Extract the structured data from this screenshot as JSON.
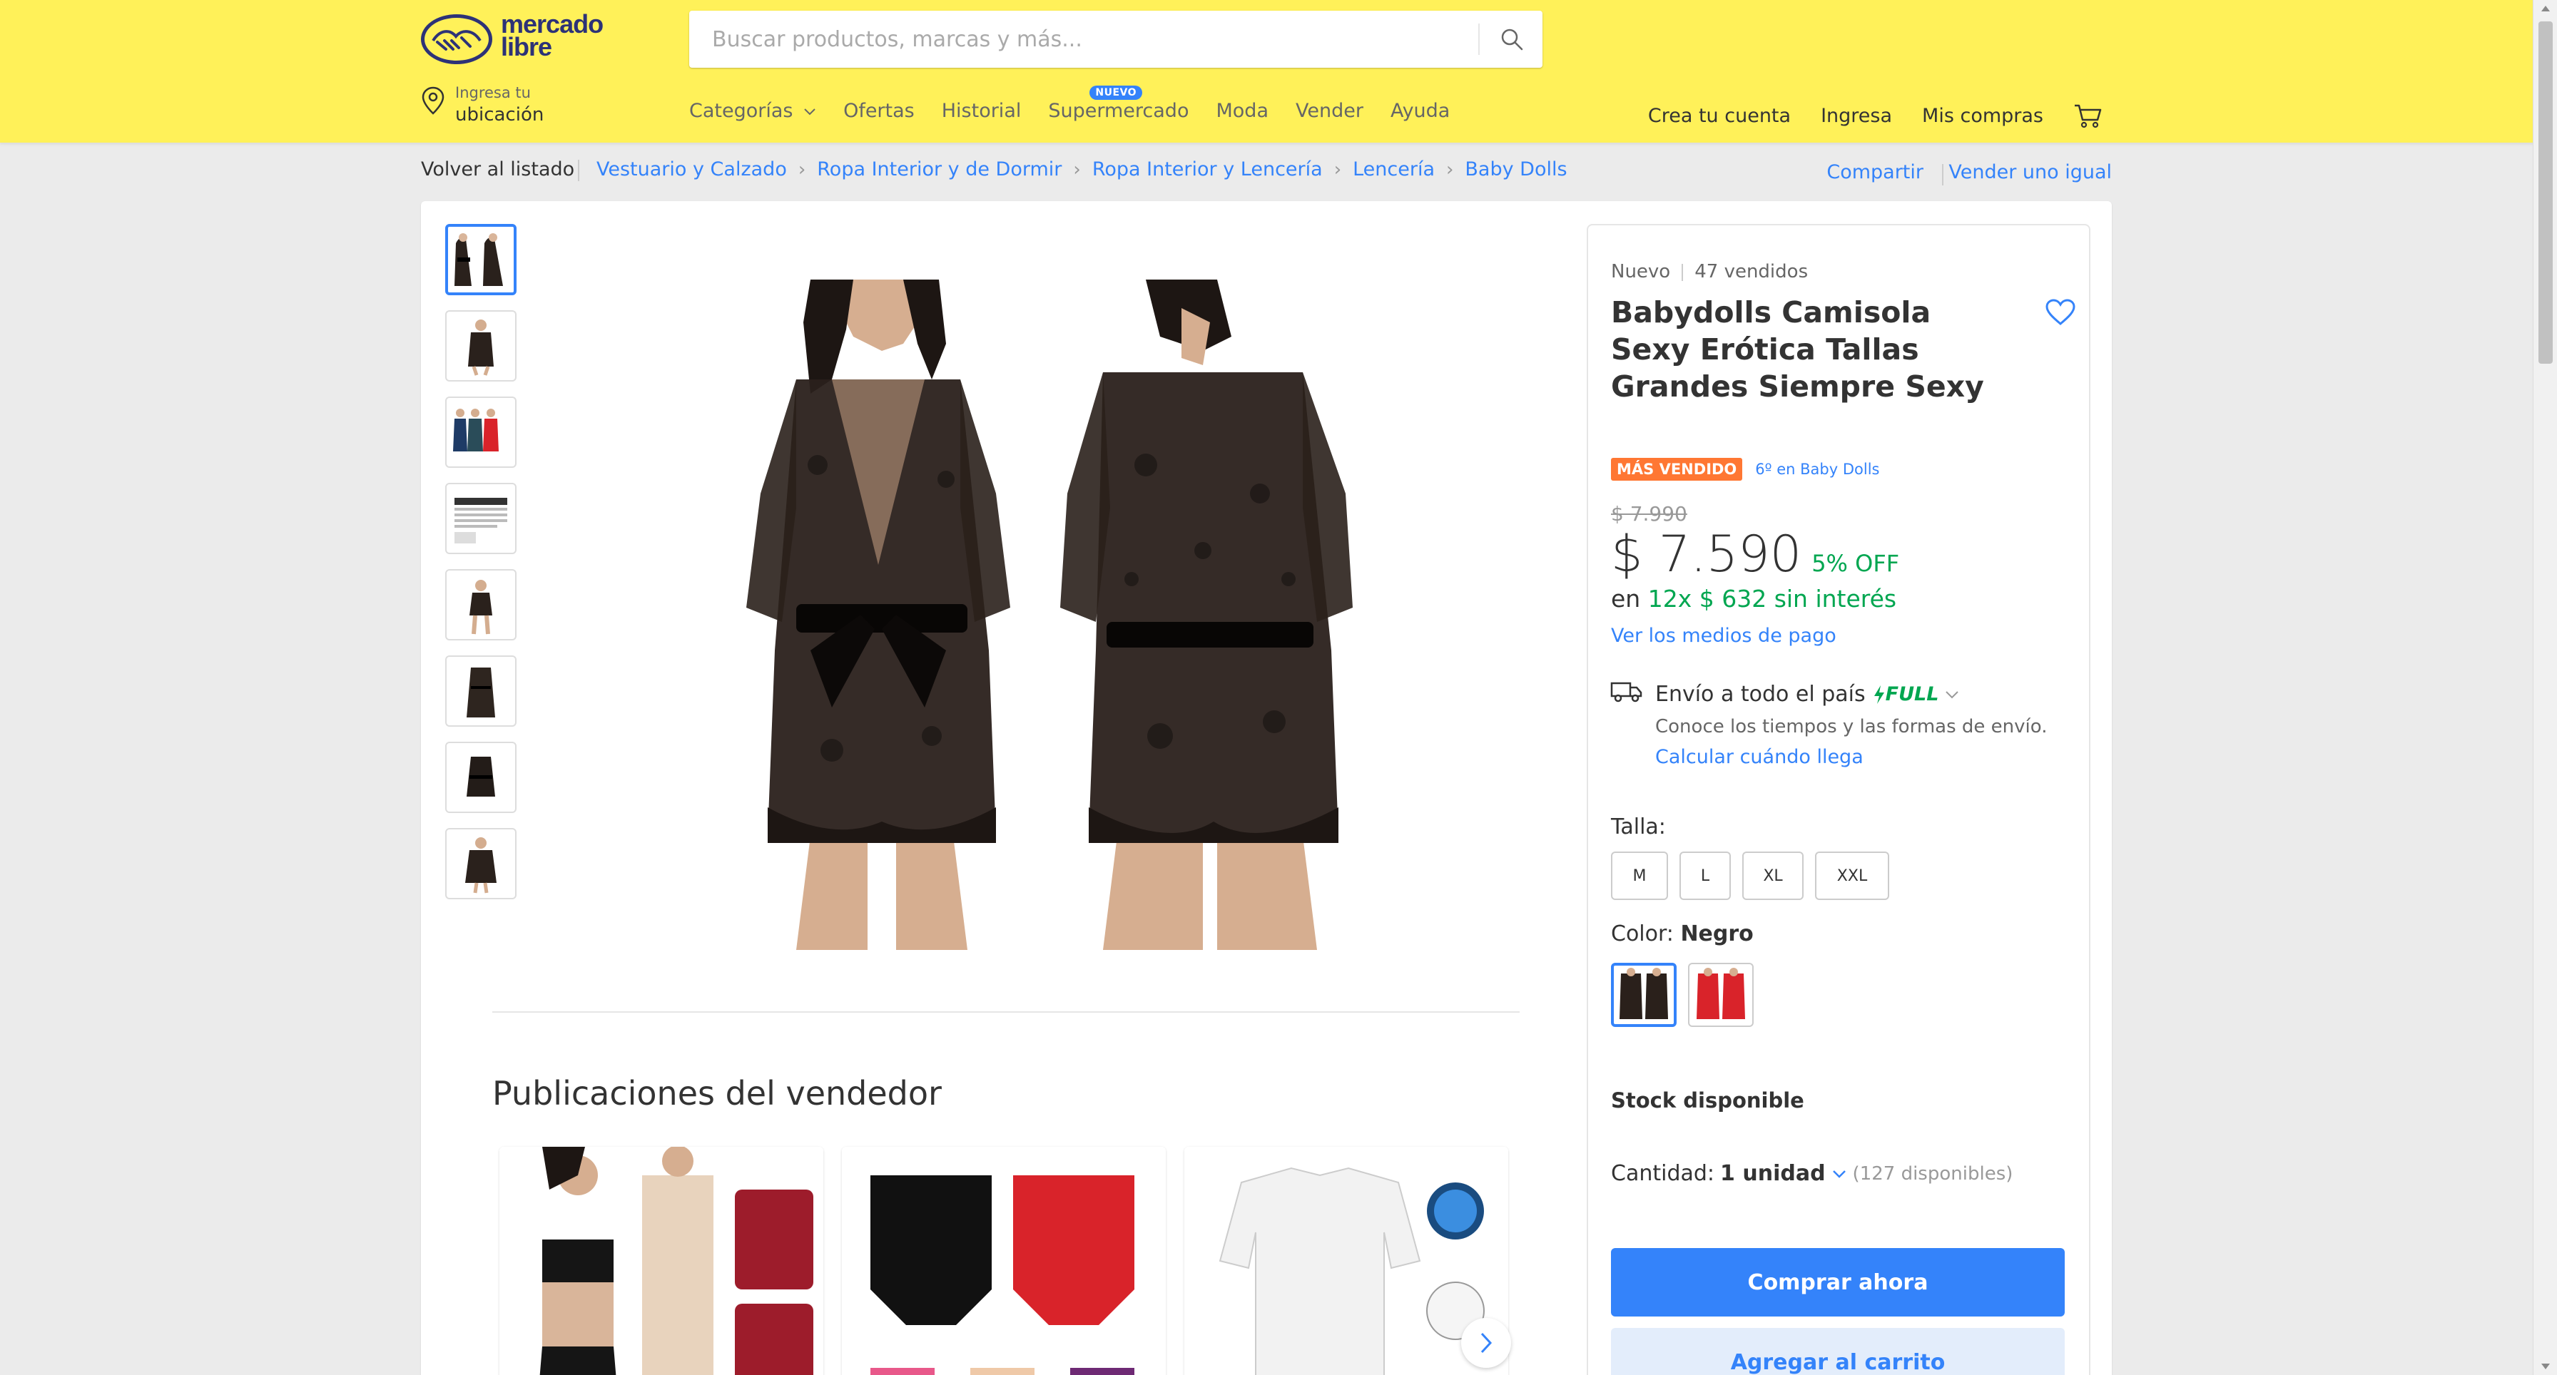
{
  "header": {
    "logo_line1": "mercado",
    "logo_line2": "libre",
    "search_placeholder": "Buscar productos, marcas y más...",
    "location_line1": "Ingresa tu",
    "location_line2": "ubicación",
    "nav": {
      "categories": "Categorías",
      "offers": "Ofertas",
      "history": "Historial",
      "supermarket": "Supermercado",
      "supermarket_badge": "NUEVO",
      "fashion": "Moda",
      "sell": "Vender",
      "help": "Ayuda"
    },
    "create_account": "Crea tu cuenta",
    "login": "Ingresa",
    "my_purchases": "Mis compras"
  },
  "breadcrumb": {
    "back": "Volver al listado",
    "items": [
      "Vestuario y Calzado",
      "Ropa Interior y de Dormir",
      "Ropa Interior y Lencería",
      "Lencería",
      "Baby Dolls"
    ],
    "share": "Compartir",
    "sell_same": "Vender uno igual"
  },
  "product": {
    "condition": "Nuevo",
    "sold": "47 vendidos",
    "title": "Babydolls Camisola Sexy Erótica Tallas Grandes Siempre Sexy",
    "badge": "MÁS VENDIDO",
    "rank": "6º en Baby Dolls",
    "original_price": "$ 7.990",
    "price": "$ 7.590",
    "discount": "5% OFF",
    "installments_prefix": "en",
    "installments": "12x $ 632 sin interés",
    "payment_link": "Ver los medios de pago",
    "shipping_title": "Envío a todo el país",
    "shipping_full": "FULL",
    "shipping_desc": "Conoce los tiempos y las formas de envío.",
    "shipping_link": "Calcular cuándo llega",
    "size_label": "Talla:",
    "sizes": [
      "M",
      "L",
      "XL",
      "XXL"
    ],
    "color_label": "Color:",
    "color_value": "Negro",
    "stock": "Stock disponible",
    "qty_label": "Cantidad:",
    "qty_value": "1 unidad",
    "qty_available": "(127 disponibles)",
    "buy_now": "Comprar ahora",
    "add_to_cart": "Agregar al carrito"
  },
  "seller_section": {
    "title": "Publicaciones del vendedor"
  },
  "colors": {
    "header_bg": "#fff159",
    "accent": "#3483fa",
    "green": "#00a650",
    "badge_orange": "#ff7733",
    "lace_black": "#1a1512",
    "red_product": "#d9232a"
  }
}
